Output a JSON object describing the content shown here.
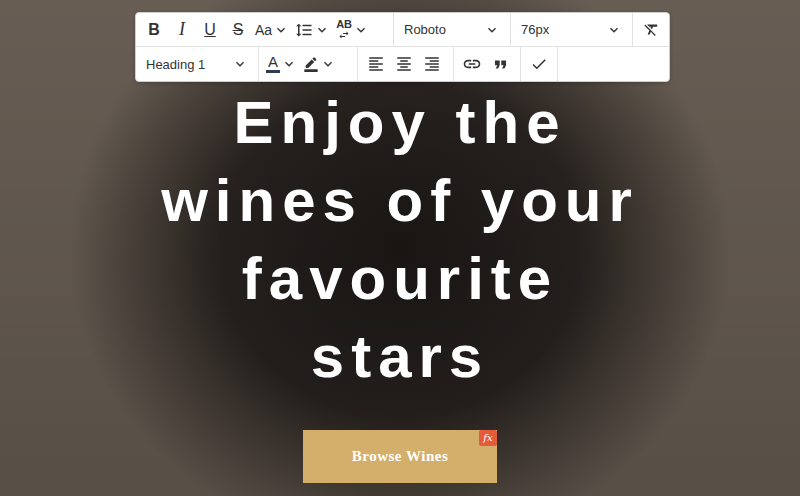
{
  "toolbar": {
    "format_buttons": [
      {
        "label": "B",
        "kind": "bold"
      },
      {
        "label": "I",
        "kind": "italic"
      },
      {
        "label": "U",
        "kind": "underline"
      },
      {
        "label": "S",
        "kind": "strike"
      }
    ],
    "case_button": "Aa",
    "spacing_button": "AB",
    "font_family": "Roboto",
    "font_size": "76px",
    "block_style": "Heading 1",
    "text_color_button": "A"
  },
  "hero": {
    "heading_lines": [
      "Enjoy the",
      "wines of your",
      "favourite",
      "stars"
    ],
    "button": "Browse Wines",
    "badge": "fx"
  }
}
